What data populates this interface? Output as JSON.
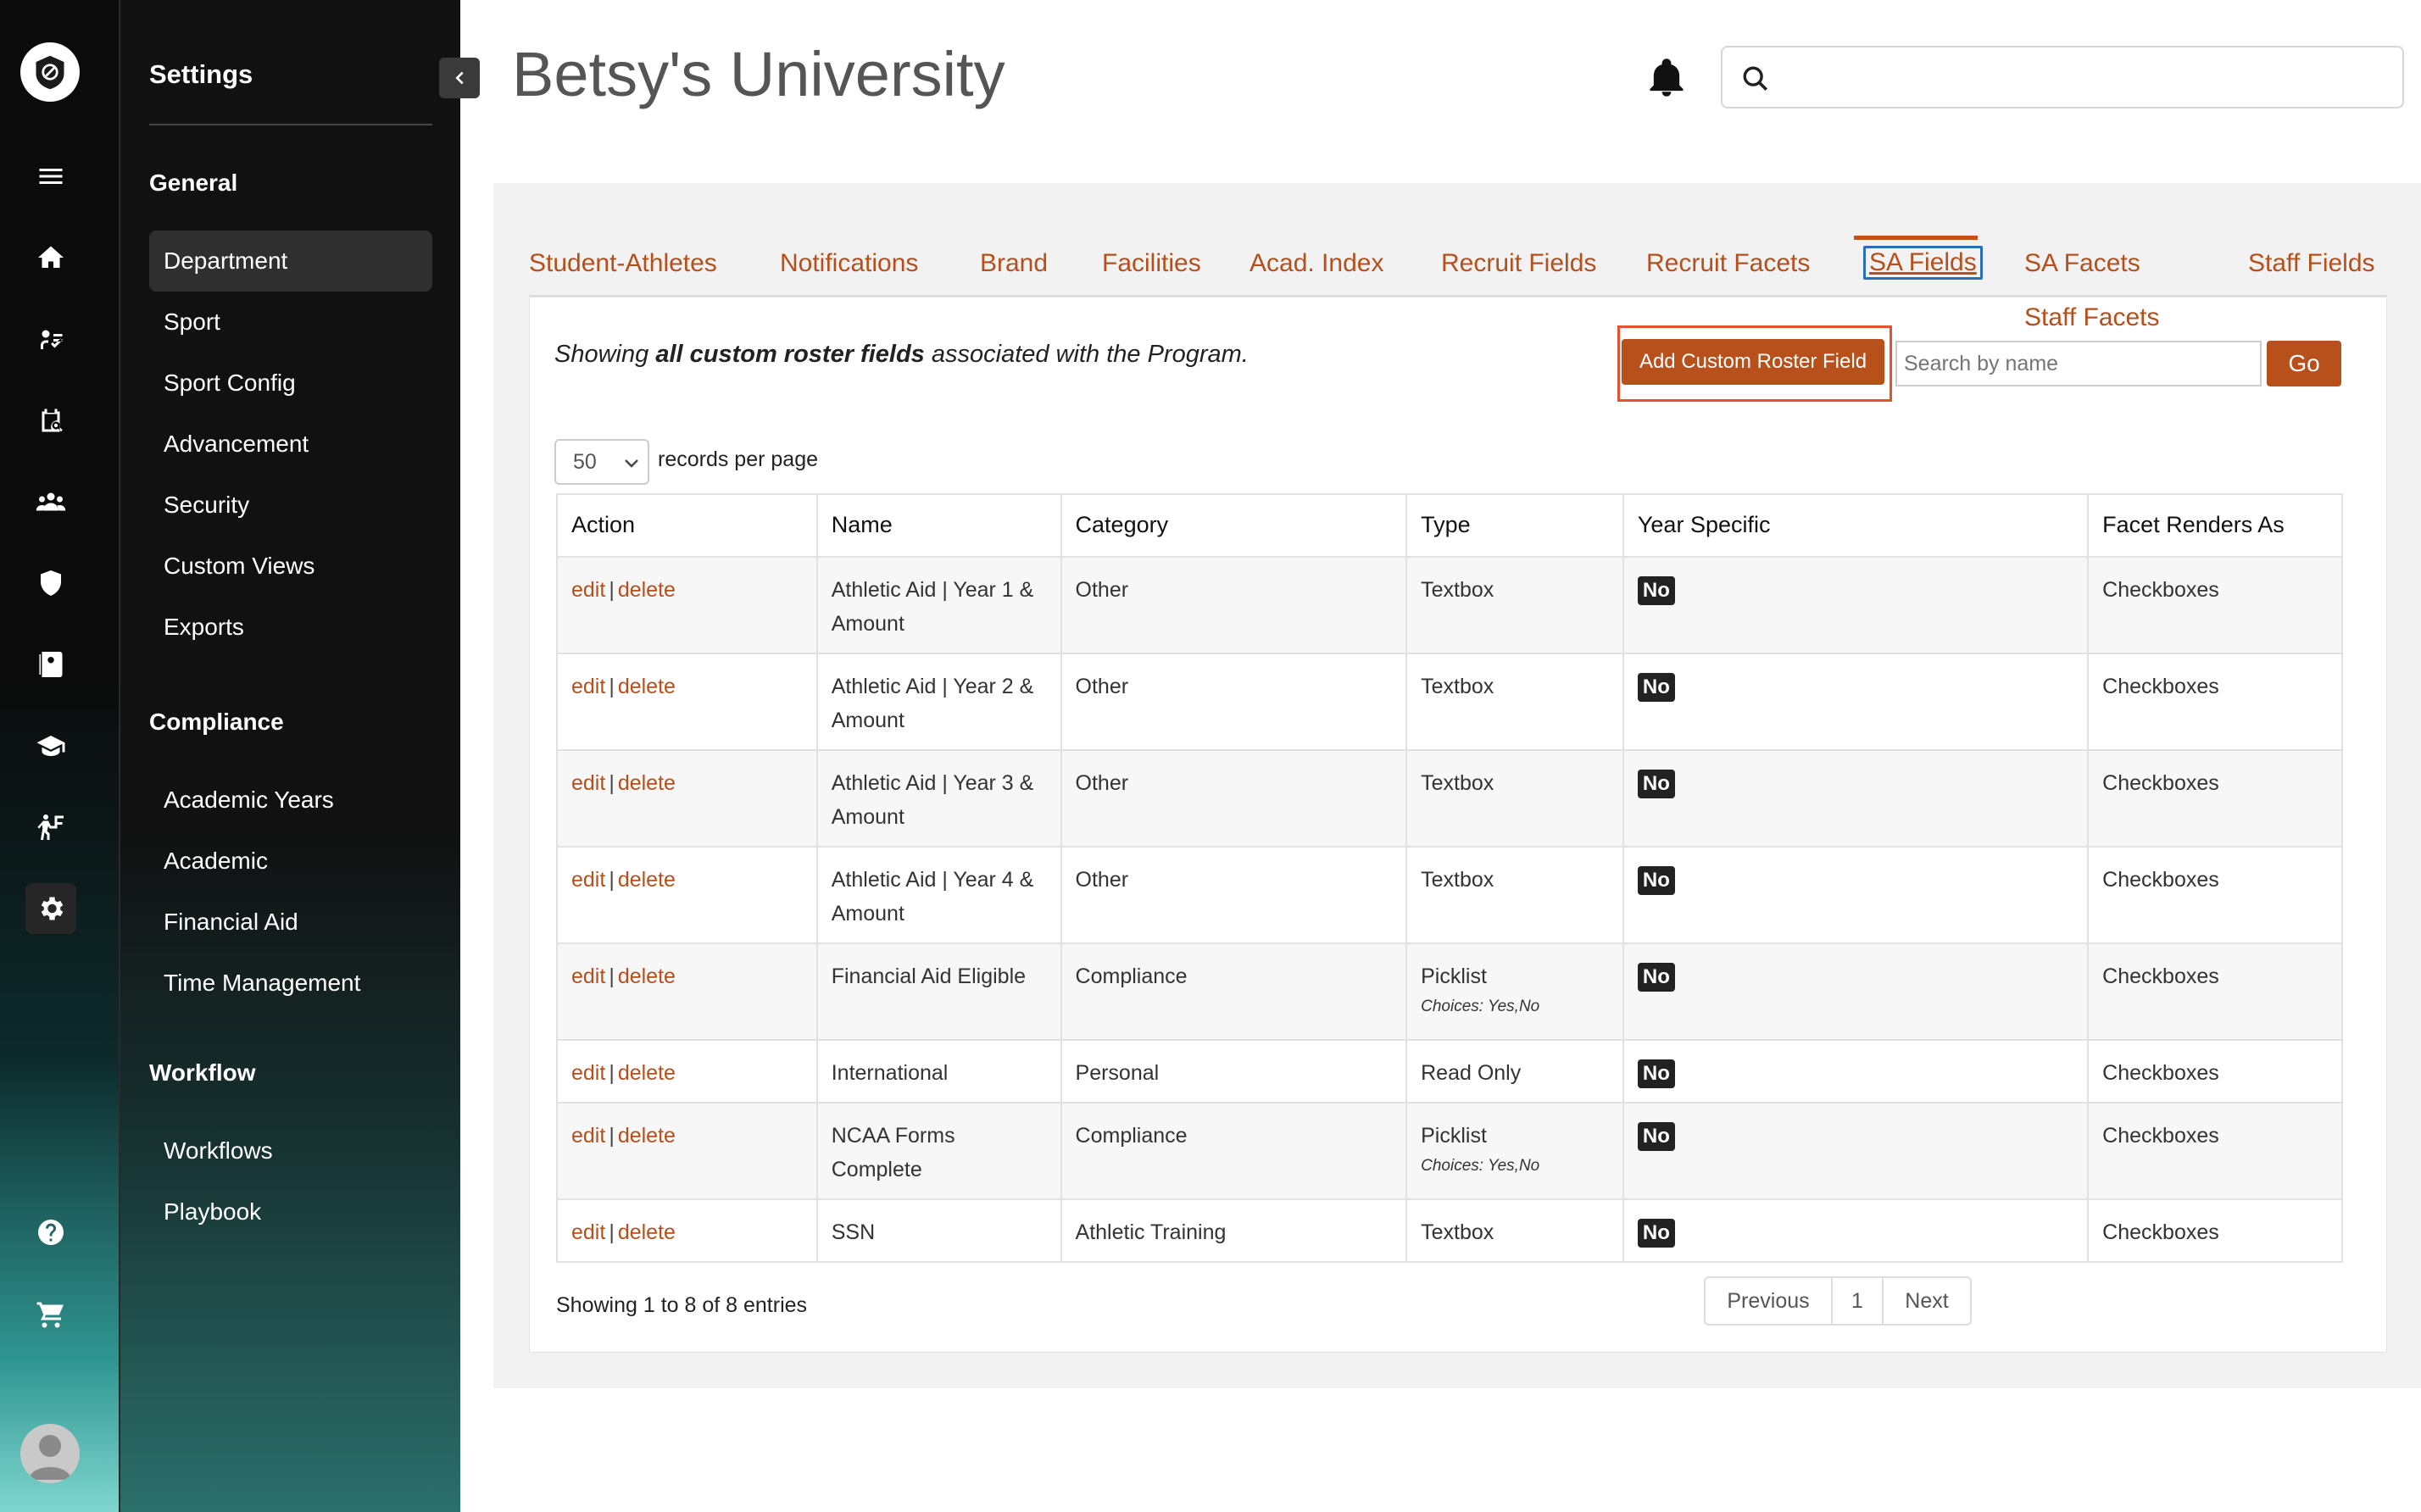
{
  "app": {
    "title": "Betsy's University"
  },
  "header": {
    "search_placeholder": ""
  },
  "sidebar": {
    "title": "Settings",
    "groups": [
      {
        "label": "General",
        "items": [
          "Department",
          "Sport",
          "Sport Config",
          "Advancement",
          "Security",
          "Custom Views",
          "Exports"
        ]
      },
      {
        "label": "Compliance",
        "items": [
          "Academic Years",
          "Academic",
          "Financial Aid",
          "Time Management"
        ]
      },
      {
        "label": "Workflow",
        "items": [
          "Workflows",
          "Playbook"
        ]
      }
    ],
    "active_item": "Department"
  },
  "rail_icons": [
    "menu-icon",
    "home-icon",
    "recruit-icon",
    "clipboard-search-icon",
    "team-icon",
    "shield-icon",
    "roster-icon",
    "graduation-cap-icon",
    "training-icon",
    "gear-icon",
    "help-icon",
    "cart-icon"
  ],
  "tabs": [
    "Student-Athletes",
    "Notifications",
    "Brand",
    "Facilities",
    "Acad. Index",
    "Recruit Fields",
    "Recruit Facets",
    "SA Fields",
    "SA Facets",
    "Staff Fields"
  ],
  "active_tab": "SA Fields",
  "staff_facets": "Staff Facets",
  "description": {
    "prefix": "Showing ",
    "bold": "all custom roster fields",
    "suffix": " associated with the Program."
  },
  "toolbar": {
    "add_button": "Add Custom Roster Field",
    "search_placeholder": "Search by name",
    "go_button": "Go",
    "per_page_value": "50",
    "per_page_label": "records per page"
  },
  "table": {
    "columns": [
      "Action",
      "Name",
      "Category",
      "Type",
      "Year Specific",
      "Facet Renders As"
    ],
    "action_edit": "edit",
    "action_delete": "delete",
    "rows": [
      {
        "name": "Athletic Aid | Year 1 & Amount",
        "category": "Other",
        "type": "Textbox",
        "choices": "",
        "year_specific": "No",
        "renders_as": "Checkboxes"
      },
      {
        "name": "Athletic Aid | Year 2 & Amount",
        "category": "Other",
        "type": "Textbox",
        "choices": "",
        "year_specific": "No",
        "renders_as": "Checkboxes"
      },
      {
        "name": "Athletic Aid | Year 3 & Amount",
        "category": "Other",
        "type": "Textbox",
        "choices": "",
        "year_specific": "No",
        "renders_as": "Checkboxes"
      },
      {
        "name": "Athletic Aid | Year 4 & Amount",
        "category": "Other",
        "type": "Textbox",
        "choices": "",
        "year_specific": "No",
        "renders_as": "Checkboxes"
      },
      {
        "name": "Financial Aid Eligible",
        "category": "Compliance",
        "type": "Picklist",
        "choices": "Choices: Yes,No",
        "year_specific": "No",
        "renders_as": "Checkboxes"
      },
      {
        "name": "International",
        "category": "Personal",
        "type": "Read Only",
        "choices": "",
        "year_specific": "No",
        "renders_as": "Checkboxes"
      },
      {
        "name": "NCAA Forms Complete",
        "category": "Compliance",
        "type": "Picklist",
        "choices": "Choices: Yes,No",
        "year_specific": "No",
        "renders_as": "Checkboxes"
      },
      {
        "name": "SSN",
        "category": "Athletic Training",
        "type": "Textbox",
        "choices": "",
        "year_specific": "No",
        "renders_as": "Checkboxes"
      }
    ]
  },
  "footer": {
    "info": "Showing 1 to 8 of 8 entries",
    "previous": "Previous",
    "page": "1",
    "next": "Next"
  },
  "colors": {
    "accent": "#b5501c",
    "highlight_box": "#e8512f",
    "active_tab_border": "#2a6fba"
  }
}
